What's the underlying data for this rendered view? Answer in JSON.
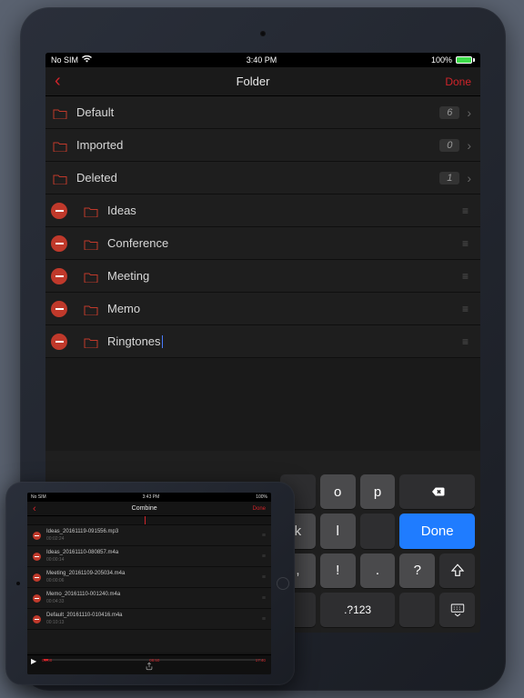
{
  "portrait": {
    "status": {
      "carrier": "No SIM",
      "wifi": true,
      "time": "3:40 PM",
      "battery_pct": "100%"
    },
    "nav": {
      "title": "Folder",
      "done": "Done"
    },
    "system_folders": [
      {
        "name": "Default",
        "count": "6"
      },
      {
        "name": "Imported",
        "count": "0"
      },
      {
        "name": "Deleted",
        "count": "1"
      }
    ],
    "user_folders": [
      {
        "name": "Ideas"
      },
      {
        "name": "Conference"
      },
      {
        "name": "Meeting"
      },
      {
        "name": "Memo"
      },
      {
        "name": "Ringtones",
        "editing": true
      }
    ],
    "keyboard": {
      "row1": [
        "o",
        "p"
      ],
      "row2": [
        "k",
        "l"
      ],
      "done": "Done",
      "row3": [
        ",",
        "!",
        ".",
        "?"
      ],
      "numkey": ".?123"
    }
  },
  "landscape": {
    "status": {
      "carrier": "No SIM",
      "time": "3:43 PM",
      "battery_pct": "100%"
    },
    "nav": {
      "title": "Combine",
      "done": "Done"
    },
    "files": [
      {
        "name": "Ideas_20161119-091556.mp3",
        "dur": "00:02:24"
      },
      {
        "name": "Ideas_20161110-080857.m4a",
        "dur": "00:00:14"
      },
      {
        "name": "Meeting_20161109-205034.m4a",
        "dur": "00:00:06"
      },
      {
        "name": "Memo_20161110-001240.m4a",
        "dur": "00:04:33"
      },
      {
        "name": "Default_20161110-010416.m4a",
        "dur": "00:10:13"
      }
    ],
    "player": {
      "pos": "00:00",
      "mid": "08:50",
      "end": "17:40"
    }
  }
}
